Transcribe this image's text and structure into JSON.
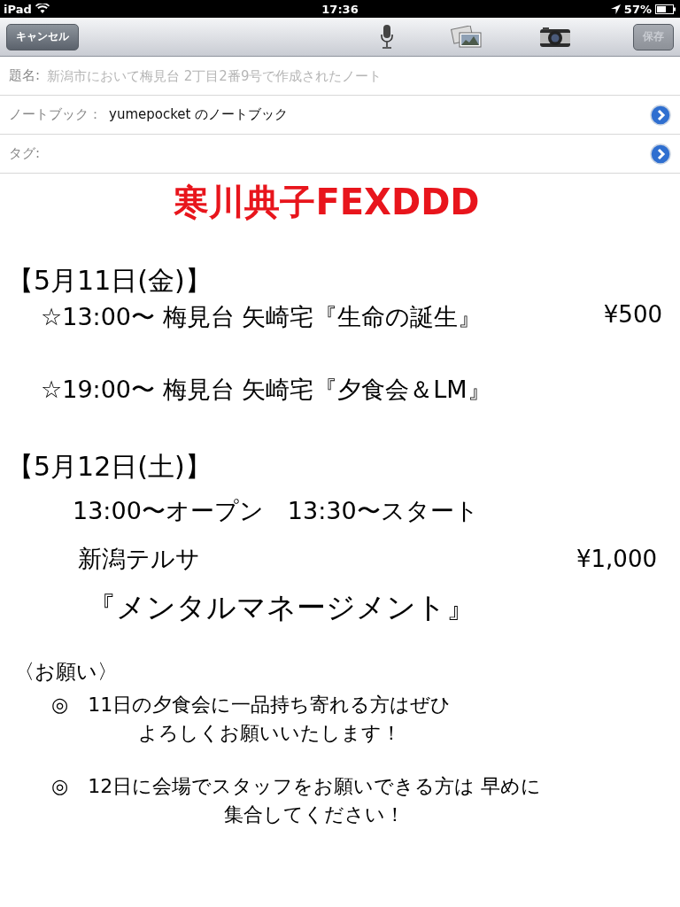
{
  "status_bar": {
    "device": "iPad",
    "time": "17:36",
    "battery": "57%"
  },
  "toolbar": {
    "cancel": "キャンセル",
    "save": {
      "label": "保存",
      "disabled": true
    }
  },
  "fields": [
    {
      "label": "題名:",
      "placeholder": "新潟市において梅見台 2丁目2番9号で作成されたノート",
      "has_button": false
    },
    {
      "label": "ノートブック：",
      "value": "yumepocket のノートブック",
      "has_button": true
    },
    {
      "label": "タグ:",
      "has_button": true
    }
  ],
  "body": [
    {
      "kind": "title",
      "text": "寒川典子FEXDDD"
    },
    {
      "kind": "date",
      "text": "【5月11日(金)】"
    },
    {
      "kind": "event",
      "text": "☆13:00〜 梅見台 矢崎宅『生命の誕生』",
      "price": "¥500"
    },
    {
      "kind": "event",
      "text": "☆19:00〜 梅見台 矢崎宅『夕食会＆LM』"
    },
    {
      "kind": "date",
      "text": "【5月12日(土)】"
    },
    {
      "kind": "time",
      "text": "13:00〜オープン　13:30〜スタート"
    },
    {
      "kind": "venue",
      "text": "新潟テルサ",
      "price": "¥1,000"
    },
    {
      "kind": "program",
      "text": "『メンタルマネージメント』"
    },
    {
      "kind": "section",
      "text": "〈お願い〉"
    },
    {
      "kind": "note",
      "mark": "◎",
      "lines": [
        "11日の夕食会に一品持ち寄れる方はぜひ",
        "よろしくお願いいたします！"
      ]
    },
    {
      "kind": "note",
      "mark": "◎",
      "lines": [
        "12日に会場でスタッフをお願いできる方は 早めに",
        "集合してください！"
      ]
    }
  ]
}
